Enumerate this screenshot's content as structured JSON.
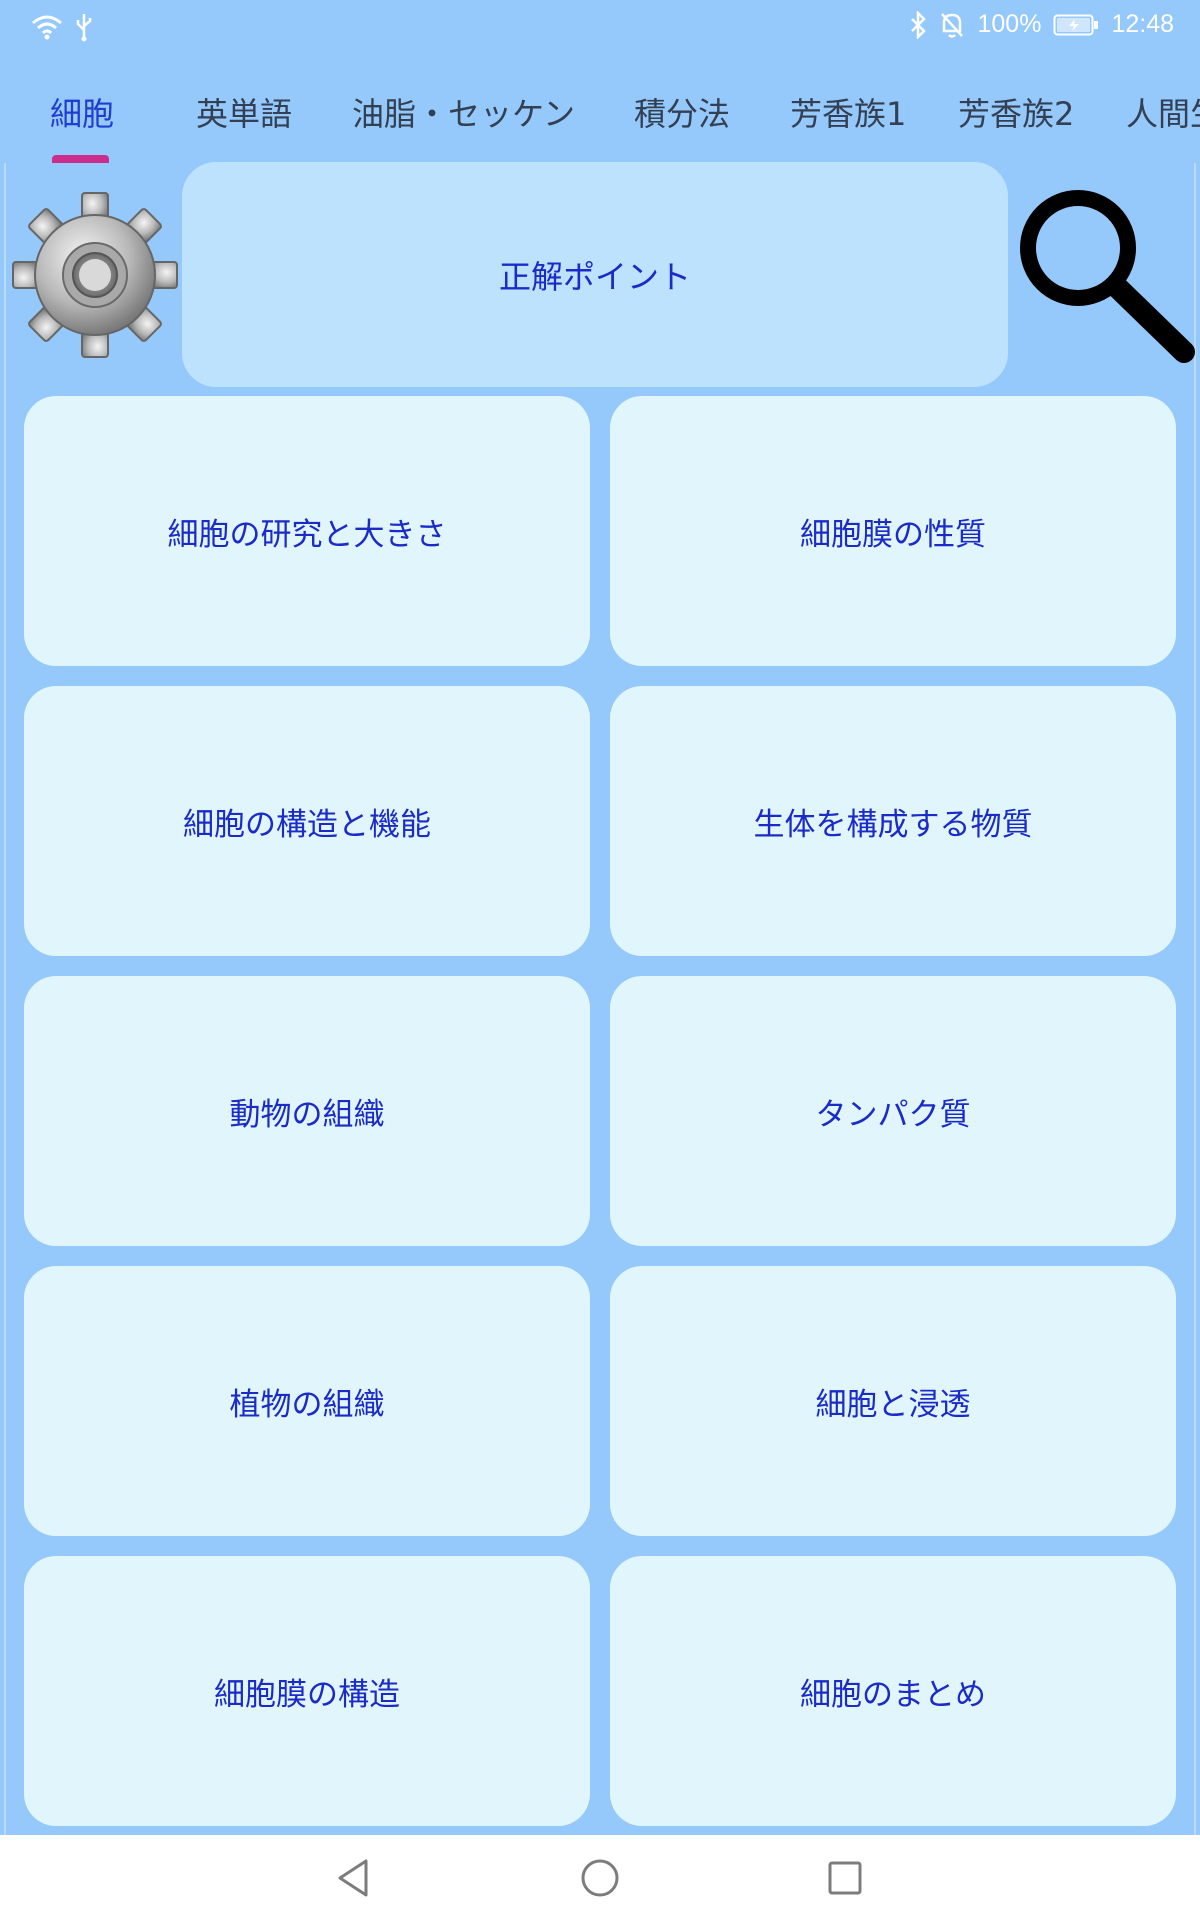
{
  "status_bar": {
    "battery_percent": "100%",
    "time": "12:48",
    "icons": [
      "wifi-icon",
      "usb-icon",
      "bluetooth-icon",
      "notifications-off-icon",
      "battery-icon"
    ]
  },
  "tabs": [
    {
      "label": "細胞",
      "active": true
    },
    {
      "label": "英単語",
      "active": false
    },
    {
      "label": "油脂・セッケン",
      "active": false
    },
    {
      "label": "積分法",
      "active": false
    },
    {
      "label": "芳香族1",
      "active": false
    },
    {
      "label": "芳香族2",
      "active": false
    },
    {
      "label": "人間生",
      "active": false
    }
  ],
  "toolbar": {
    "settings_icon": "gear-icon",
    "hint_label": "正解ポイント",
    "search_icon": "magnifier-icon"
  },
  "topics": [
    "細胞の研究と大きさ",
    "細胞膜の性質",
    "細胞の構造と機能",
    "生体を構成する物質",
    "動物の組織",
    "タンパク質",
    "植物の組織",
    "細胞と浸透",
    "細胞膜の構造",
    "細胞のまとめ"
  ],
  "nav": {
    "icons": [
      "back-icon",
      "home-icon",
      "recents-icon"
    ]
  },
  "colors": {
    "background": "#95c8fb",
    "card": "#e1f5fd",
    "hint_button": "#bde2fe",
    "text": "#1a2bc8",
    "active_tab": "#1f3fd0",
    "tab_indicator": "#cc2c8c"
  }
}
